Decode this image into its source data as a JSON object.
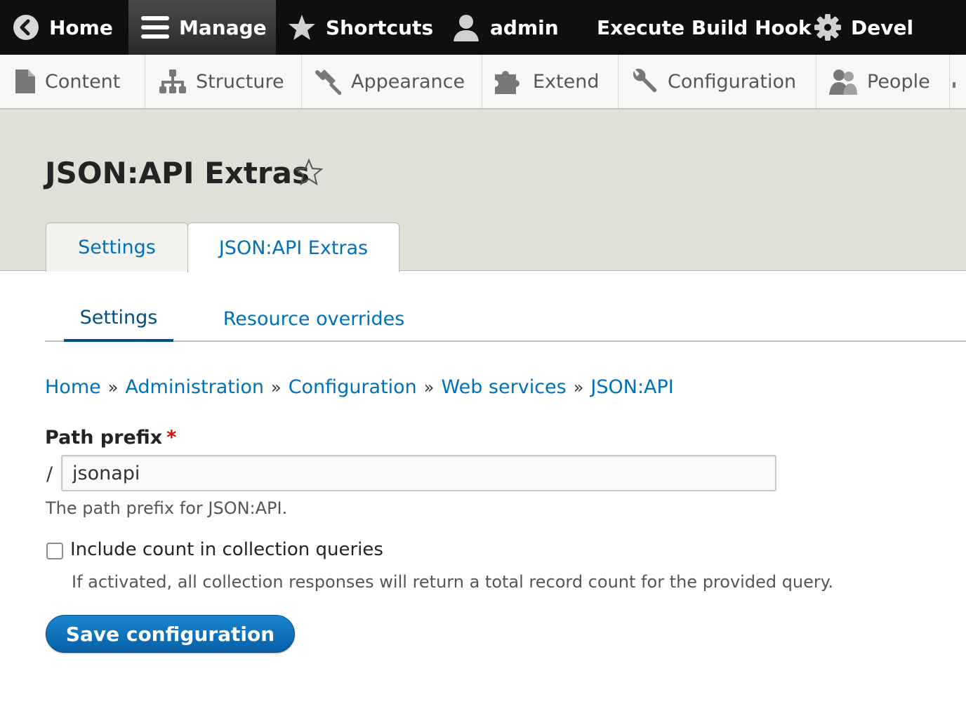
{
  "toolbar": {
    "items": [
      {
        "label": "Home",
        "icon": "chevron-left-circle-icon"
      },
      {
        "label": "Manage",
        "icon": "hamburger-menu-icon",
        "active": true
      },
      {
        "label": "Shortcuts",
        "icon": "star-icon"
      },
      {
        "label": "admin",
        "icon": "user-icon"
      },
      {
        "label": "Execute Build Hook"
      },
      {
        "label": "Devel",
        "icon": "gear-icon"
      }
    ]
  },
  "tray": {
    "items": [
      {
        "label": "Content",
        "icon": "document-icon"
      },
      {
        "label": "Structure",
        "icon": "hierarchy-icon"
      },
      {
        "label": "Appearance",
        "icon": "paintbrush-icon"
      },
      {
        "label": "Extend",
        "icon": "puzzle-icon"
      },
      {
        "label": "Configuration",
        "icon": "wrench-icon"
      },
      {
        "label": "People",
        "icon": "people-icon"
      }
    ]
  },
  "page": {
    "title": "JSON:API Extras"
  },
  "primary_tabs": [
    {
      "label": "Settings",
      "active": false
    },
    {
      "label": "JSON:API Extras",
      "active": true
    }
  ],
  "secondary_tabs": [
    {
      "label": "Settings",
      "active": true
    },
    {
      "label": "Resource overrides",
      "active": false
    }
  ],
  "breadcrumb": {
    "separator": "»",
    "items": [
      "Home",
      "Administration",
      "Configuration",
      "Web services",
      "JSON:API"
    ]
  },
  "form": {
    "path_prefix": {
      "label": "Path prefix",
      "required_marker": "*",
      "prefix": "/",
      "value": "jsonapi",
      "description": "The path prefix for JSON:API."
    },
    "include_count": {
      "label": "Include count in collection queries",
      "checked": false,
      "description": "If activated, all collection responses will return a total record count for the provided query."
    },
    "submit_label": "Save configuration"
  },
  "colors": {
    "toolbar_bg": "#0f0f0f",
    "link": "#0071b8",
    "primary_button": "#0b6fba",
    "required": "#e00000"
  }
}
